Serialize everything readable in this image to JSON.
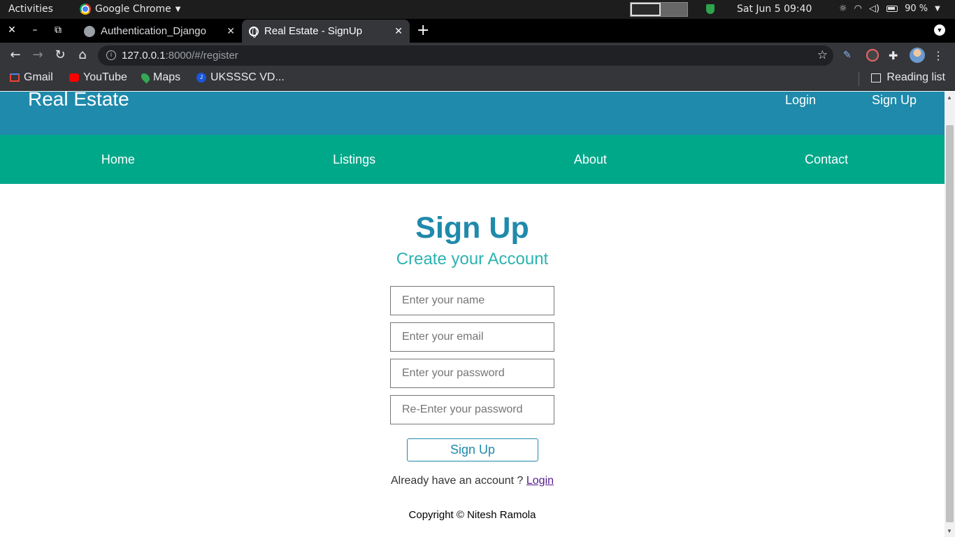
{
  "os_bar": {
    "activities": "Activities",
    "app_name": "Google Chrome",
    "datetime": "Sat Jun 5  09:40",
    "battery": "90 %"
  },
  "browser": {
    "tabs": [
      {
        "title": "Authentication_Django",
        "active": false,
        "icon": "github-icon"
      },
      {
        "title": "Real Estate - SignUp",
        "active": true,
        "icon": "globe-icon"
      }
    ],
    "url_host": "127.0.0.1",
    "url_rest": ":8000/#/register",
    "bookmarks": [
      "Gmail",
      "YouTube",
      "Maps",
      "UKSSSC VD..."
    ],
    "reading_list": "Reading list"
  },
  "site": {
    "brand": "Real Estate",
    "header_links": {
      "login": "Login",
      "signup": "Sign Up"
    },
    "nav": [
      "Home",
      "Listings",
      "About",
      "Contact"
    ],
    "colors": {
      "header": "#1f8aab",
      "nav": "#00a88a",
      "subtitle": "#2cb3b0"
    }
  },
  "form": {
    "title": "Sign Up",
    "subtitle": "Create your Account",
    "name_placeholder": "Enter your name",
    "email_placeholder": "Enter your email",
    "password_placeholder": "Enter your password",
    "repassword_placeholder": "Re-Enter your password",
    "submit": "Sign Up",
    "already_text": "Already have an account ? ",
    "login_link": "Login"
  },
  "footer": {
    "copyright": "Copyright © Nitesh Ramola"
  }
}
